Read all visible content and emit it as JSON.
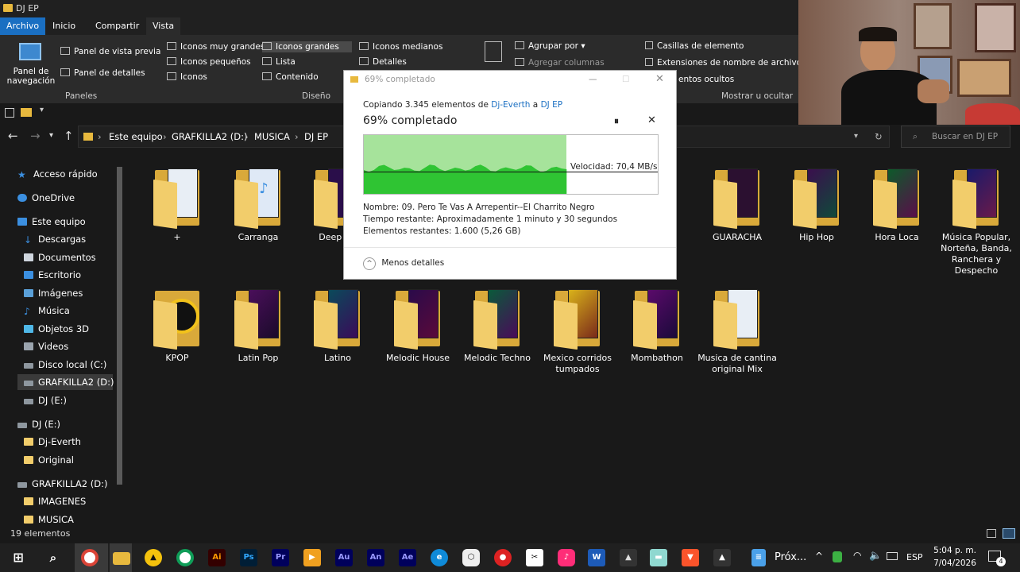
{
  "window": {
    "title": "DJ EP"
  },
  "ribbon_tabs": [
    "Archivo",
    "Inicio",
    "Compartir",
    "Vista"
  ],
  "ribbon": {
    "panel_navegacion": "Panel de\nnavegación",
    "panel_vista_previa": "Panel de vista previa",
    "panel_detalles": "Panel de detalles",
    "group_paneles": "Paneles",
    "layout_options": [
      "Iconos muy grandes",
      "Iconos grandes",
      "Iconos medianos",
      "Iconos pequeños",
      "Lista",
      "Detalles",
      "Iconos",
      "Contenido"
    ],
    "group_diseno": "Diseño",
    "agrupar_por": "Agrupar por",
    "agregar_columnas": "Agregar columnas",
    "casillas": "Casillas de elemento",
    "extensiones": "Extensiones de nombre de archivo",
    "ocultos": "entos ocultos",
    "group_mostrar": "Mostrar u ocultar"
  },
  "breadcrumb": [
    "Este equipo",
    "GRAFKILLA2 (D:)",
    "MUSICA",
    "DJ EP"
  ],
  "search": {
    "placeholder": "Buscar en DJ EP"
  },
  "sidebar": {
    "items": [
      "Acceso rápido",
      "OneDrive",
      "Este equipo",
      "Descargas",
      "Documentos",
      "Escritorio",
      "Imágenes",
      "Música",
      "Objetos 3D",
      "Videos",
      "Disco local (C:)",
      "GRAFKILLA2 (D:)",
      "DJ (E:)",
      "DJ (E:)",
      "Dj-Everth",
      "Original",
      "GRAFKILLA2 (D:)",
      "IMAGENES",
      "MUSICA"
    ]
  },
  "folders": [
    "+",
    "Carranga",
    "Deep Ho",
    "GUARACHA",
    "Hip Hop",
    "Hora Loca",
    "Música Popular, Norteña, Banda, Ranchera y Despecho",
    "KPOP",
    "Latin Pop",
    "Latino",
    "Melodic House",
    "Melodic Techno",
    "Mexico corridos tumpados",
    "Mombathon",
    "Musica de cantina original Mix"
  ],
  "status": {
    "count": "19 elementos"
  },
  "dialog": {
    "title": "69% completado",
    "copy_prefix": "Copiando 3.345 elementos de",
    "source": "Dj-Everth",
    "to": "a",
    "dest": "DJ EP",
    "heading": "69% completado",
    "speed": "Velocidad: 70,4 MB/s",
    "name_line": "Nombre:  09. Pero Te Vas A Arrepentir--El Charrito Negro",
    "time_line": "Tiempo restante:  Aproximadamente 1 minuto y 30 segundos",
    "items_line": "Elementos restantes:  1.600 (5,26 GB)",
    "less_details": "Menos detalles",
    "progress": 0.69
  },
  "taskbar": {
    "prox": "Próx...",
    "lang": "ESP",
    "time": "5:04 p. m.",
    "date": "7/04/2026",
    "notif": "4"
  },
  "colors": {
    "accent": "#1a6fc2",
    "folder": "#f2cd6b",
    "progress": "#a6e39b",
    "progress_dark": "#2fc433"
  }
}
